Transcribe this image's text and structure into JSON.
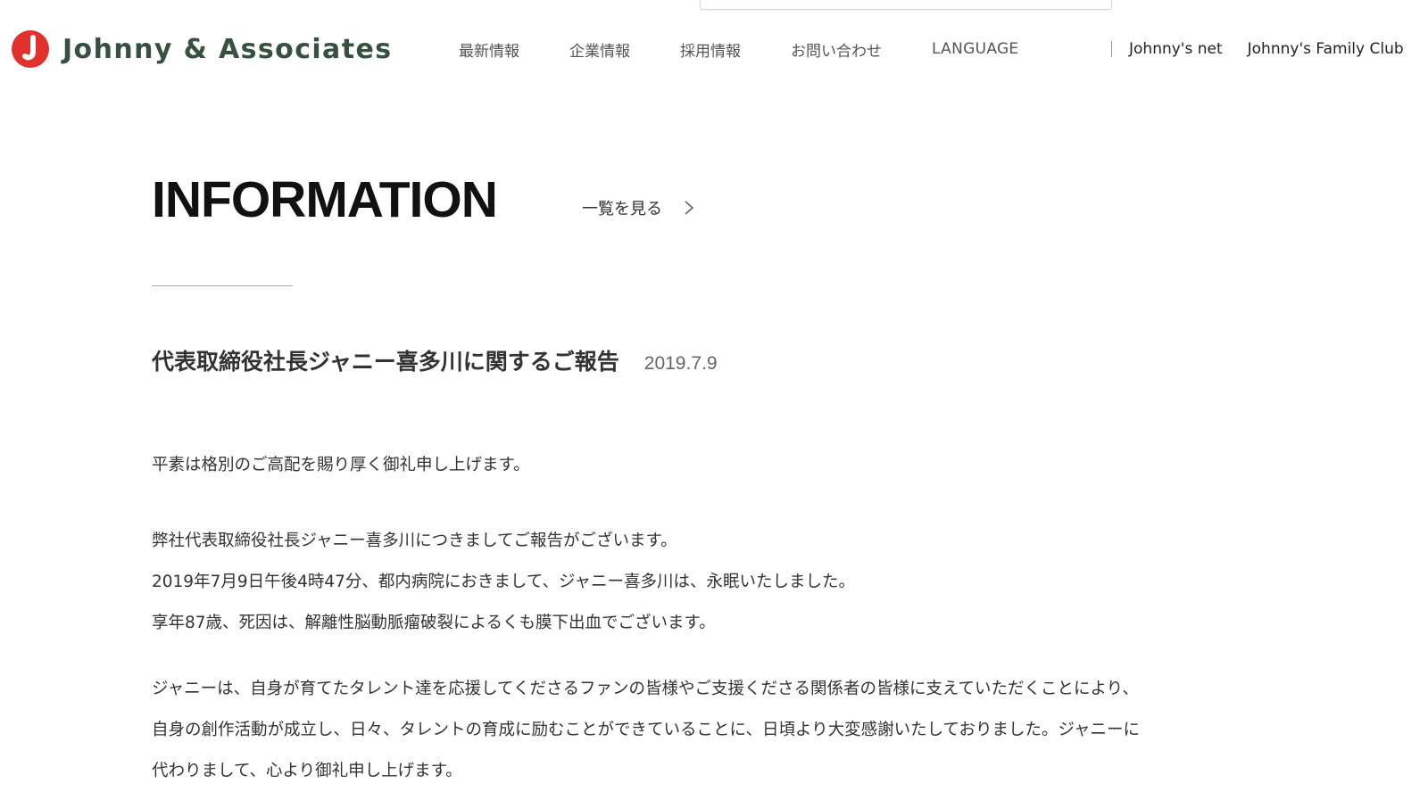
{
  "header": {
    "brand": "Johnny & Associates",
    "brand_color": "#36513f",
    "logo_color": "#e2302a",
    "nav": [
      {
        "label": "最新情報"
      },
      {
        "label": "企業情報"
      },
      {
        "label": "採用情報"
      },
      {
        "label": "お問い合わせ"
      },
      {
        "label": "LANGUAGE"
      }
    ],
    "external": [
      {
        "label": "Johnny's net"
      },
      {
        "label": "Johnny's Family Club"
      }
    ]
  },
  "section": {
    "title": "INFORMATION",
    "view_all": "一覧を見る"
  },
  "article": {
    "title": "代表取締役社長ジャニー喜多川に関するご報告",
    "date": "2019.7.9",
    "p1": [
      "平素は格別のご高配を賜り厚く御礼申し上げます。"
    ],
    "p2": [
      "弊社代表取締役社長ジャニー喜多川につきましてご報告がございます。",
      "2019年7月9日午後4時47分、都内病院におきまして、ジャニー喜多川は、永眠いたしました。",
      "享年87歳、死因は、解離性脳動脈瘤破裂によるくも膜下出血でございます。"
    ],
    "p3": [
      "ジャニーは、自身が育てたタレント達を応援してくださるファンの皆様やご支援くださる関係者の皆様に支えていただくことにより、",
      "自身の創作活動が成立し、日々、タレントの育成に励むことができていることに、日頃より大変感謝いたしておりました。ジャニーに",
      "代わりまして、心より御礼申し上げます。"
    ]
  }
}
